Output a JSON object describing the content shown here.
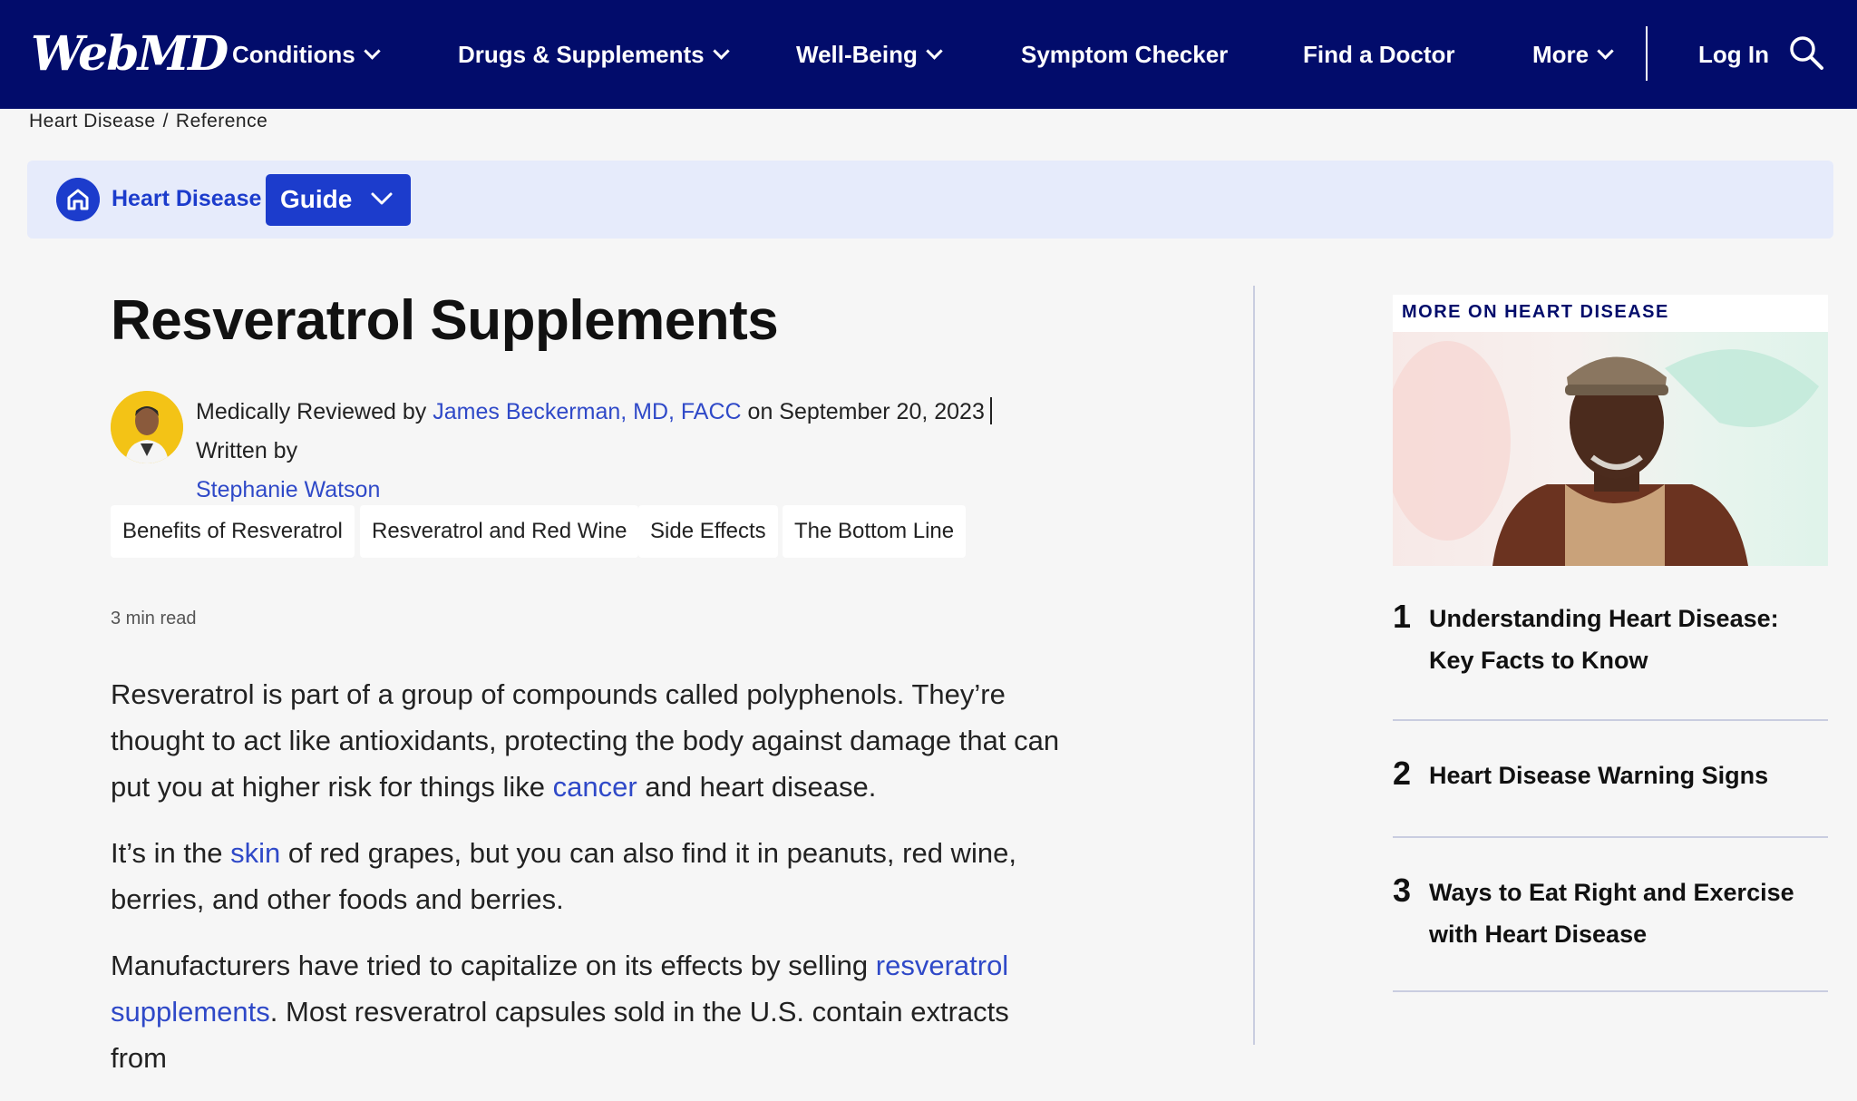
{
  "nav": {
    "logo": "WebMD",
    "items": [
      {
        "label": "Conditions",
        "dropdown": true
      },
      {
        "label": "Drugs & Supplements",
        "dropdown": true
      },
      {
        "label": "Well-Being",
        "dropdown": true
      },
      {
        "label": "Symptom Checker",
        "dropdown": false
      },
      {
        "label": "Find a Doctor",
        "dropdown": false
      },
      {
        "label": "More",
        "dropdown": true
      }
    ],
    "login": "Log In",
    "search_icon": "search-icon"
  },
  "breadcrumb": {
    "items": [
      "Heart Disease",
      "Reference"
    ],
    "separator": "/"
  },
  "guide": {
    "topic": "Heart Disease",
    "dropdown_label": "Guide",
    "home_icon": "home-icon"
  },
  "article": {
    "title": "Resveratrol Supplements",
    "byline": {
      "reviewed_prefix": "Medically Reviewed by",
      "reviewer": "James Beckerman, MD, FACC",
      "date_text": "on September 20, 2023",
      "written_prefix": "Written by",
      "author": "Stephanie Watson"
    },
    "chips": [
      "Benefits of Resveratrol",
      "Resveratrol and Red Wine",
      "Side Effects",
      "The Bottom Line"
    ],
    "read_time": "3 min read",
    "paragraphs": [
      {
        "before": "Resveratrol is part of a group of compounds called polyphenols. They’re thought to act like antioxidants, protecting the body against damage that can put you at higher risk for things like ",
        "link": "cancer",
        "after": " and heart disease."
      },
      {
        "before": "It’s in the ",
        "link": "skin",
        "after": " of red grapes, but you can also find it in peanuts, red wine, berries, and other foods and berries."
      },
      {
        "before": "Manufacturers have tried to capitalize on its effects by selling ",
        "link": "resveratrol supplements",
        "after": ". Most resveratrol capsules sold in the U.S. contain extracts from"
      }
    ]
  },
  "sidebar": {
    "heading": "MORE ON HEART DISEASE",
    "items": [
      {
        "num": "1",
        "text": "Understanding Heart Disease: Key Facts to Know"
      },
      {
        "num": "2",
        "text": "Heart Disease Warning Signs"
      },
      {
        "num": "3",
        "text": "Ways to Eat Right and Exercise with Heart Disease"
      }
    ]
  },
  "colors": {
    "nav_bg": "#020c6b",
    "accent": "#1c3ccc",
    "link": "#2f49c8",
    "guide_bar_bg": "#e6ebfb",
    "page_bg": "#f6f6f6"
  }
}
